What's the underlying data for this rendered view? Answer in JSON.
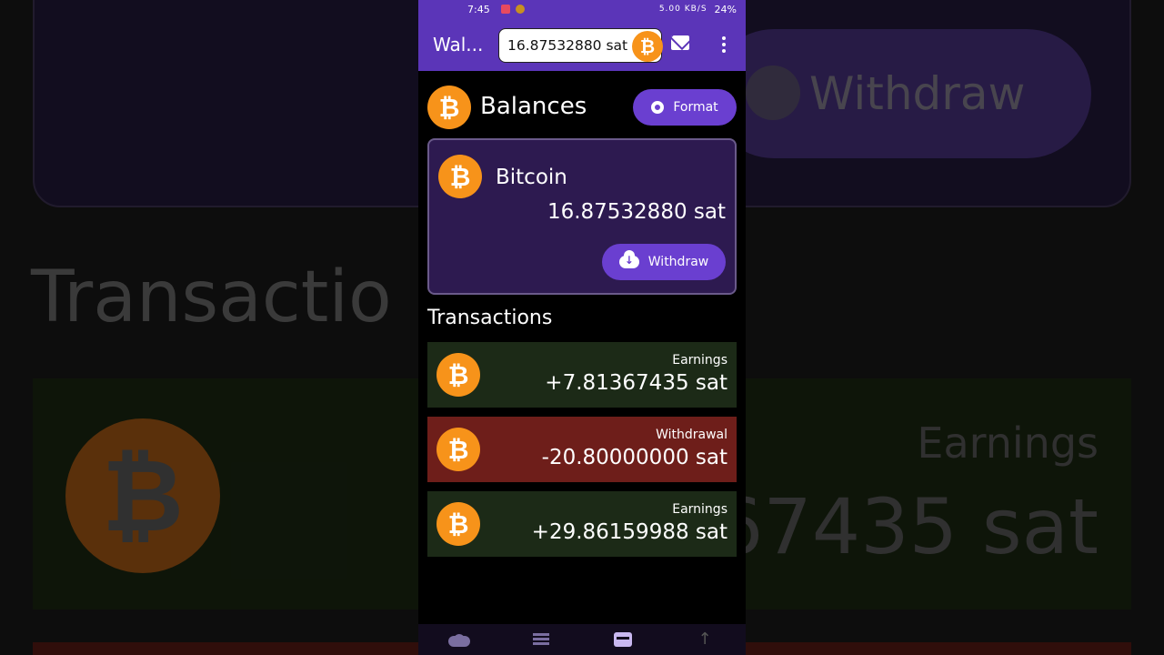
{
  "background": {
    "withdraw_label": "Withdraw",
    "transactions_label": "Transactio",
    "earnings_label": "Earnings",
    "amount_fragment": ".67435 sat"
  },
  "status_bar": {
    "time": "7:45",
    "network": "5.00 KB/S",
    "battery": "24%"
  },
  "app_bar": {
    "title": "Wal...",
    "balance": "16.87532880 sat"
  },
  "balances": {
    "heading": "Balances",
    "format_label": "Format"
  },
  "wallet": {
    "name": "Bitcoin",
    "amount": "16.87532880 sat",
    "withdraw_label": "Withdraw"
  },
  "transactions": {
    "heading": "Transactions",
    "items": [
      {
        "type": "Earnings",
        "amount": "+7.81367435 sat"
      },
      {
        "type": "Withdrawal",
        "amount": "-20.80000000 sat"
      },
      {
        "type": "Earnings",
        "amount": "+29.86159988 sat"
      }
    ]
  },
  "colors": {
    "primary": "#5b35b8",
    "button": "#6a3fd0",
    "bitcoin": "#f7931a",
    "earnings_row": "#1c2a17",
    "withdrawal_row": "#6e1e1a"
  },
  "icons": {
    "coin": "bitcoin-icon",
    "mail": "mail-icon",
    "more": "more-vert-icon",
    "format": "gear-icon",
    "withdraw": "cloud-download-icon",
    "nav": [
      "cloud-icon",
      "list-icon",
      "wallet-icon",
      "arrow-up-icon"
    ]
  },
  "bitcoin_glyph": "₿"
}
